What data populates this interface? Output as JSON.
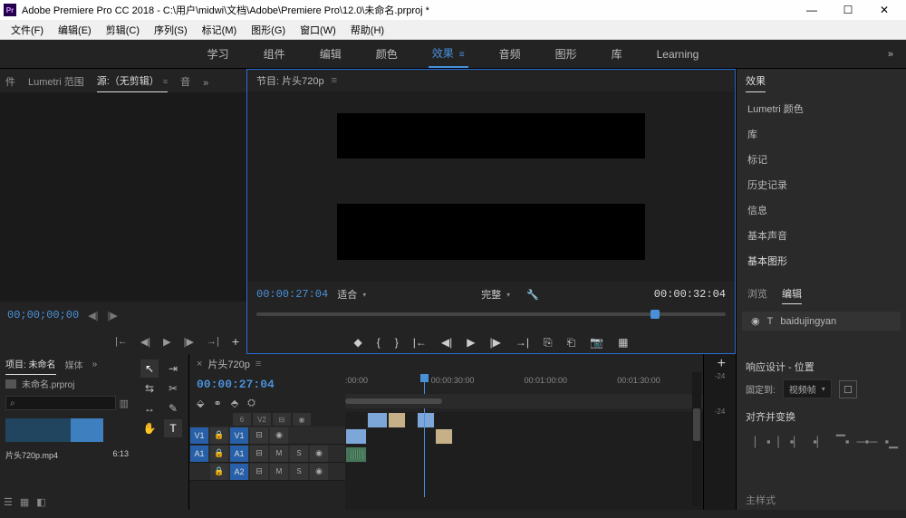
{
  "titlebar": {
    "app_abbrev": "Pr",
    "title": "Adobe Premiere Pro CC 2018 - C:\\用户\\midwi\\文档\\Adobe\\Premiere Pro\\12.0\\未命名.prproj *"
  },
  "menu": {
    "file": "文件(F)",
    "edit": "编辑(E)",
    "clip": "剪辑(C)",
    "sequence": "序列(S)",
    "marker": "标记(M)",
    "graphics": "图形(G)",
    "window": "窗口(W)",
    "help": "帮助(H)"
  },
  "workspaces": {
    "learn": "学习",
    "assembly": "组件",
    "editing": "编辑",
    "color": "颜色",
    "effects": "效果",
    "audio": "音频",
    "graphics": "图形",
    "library": "库",
    "learning": "Learning",
    "more": "»"
  },
  "source_panel": {
    "tab_prefix": "件",
    "tab_lumetri": "Lumetri 范围",
    "tab_source": "源:（无剪辑）",
    "tab_audio_prefix": "音",
    "more": "»",
    "timecode": "00;00;00;00"
  },
  "program_panel": {
    "label_prefix": "节目:",
    "sequence_name": "片头720p",
    "current_tc": "00:00:27:04",
    "fit_label": "适合",
    "quality_label": "完整",
    "duration_tc": "00:00:32:04"
  },
  "effects_panel": {
    "tab": "效果",
    "items": {
      "lumetri": "Lumetri 颜色",
      "library": "库",
      "markers": "标记",
      "history": "历史记录",
      "info": "信息",
      "essential_sound": "基本声音",
      "essential_graphics": "基本图形"
    },
    "subtab_browse": "浏览",
    "subtab_edit": "编辑",
    "layer_name": "baidujingyan"
  },
  "project_panel": {
    "tab_project": "项目: 未命名",
    "tab_media": "媒体",
    "more": "»",
    "project_file": "未命名.prproj",
    "search_placeholder": "⌕",
    "clip_name": "片头720p.mp4",
    "clip_dur": "6:13"
  },
  "timeline_panel": {
    "sequence_name": "片头720p",
    "current_tc": "00:00:27:04",
    "ruler": {
      "t0": ":00:00",
      "t1": "00:00:30:00",
      "t2": "00:01:00:00",
      "t3": "00:01:30:00"
    },
    "tracks": {
      "v2": "V2",
      "v1": "V1",
      "a1": "A1",
      "a2": "A2",
      "v1_src": "V1",
      "a1_src": "A1",
      "m": "M",
      "s": "S"
    }
  },
  "right_bottom": {
    "responsive_title": "响应设计 - 位置",
    "pin_label": "固定到:",
    "pin_value": "视频帧",
    "align_title": "对齐并变换",
    "style_title": "主样式"
  },
  "audio_meter": {
    "m24a": "-24",
    "m24b": "-24"
  },
  "icons": {
    "minimize": "—",
    "maximize": "☐",
    "close": "✕",
    "play": "▶",
    "step_back": "◀|",
    "step_fwd": "|▶",
    "prev": "|◀◀",
    "next": "▶▶|",
    "mark_in": "{",
    "mark_out": "}",
    "marker": "◆",
    "go_in": "|←",
    "go_out": "→|",
    "lift": "▭↑",
    "extract": "▭↓",
    "camera": "📷",
    "export": "▦",
    "plus": "+",
    "wrench": "🔧",
    "arrow_down": "▾",
    "eye": "◉",
    "type": "T",
    "lock": "🔒",
    "snap": "�磁",
    "link": "⚭",
    "settings": "⛭"
  }
}
